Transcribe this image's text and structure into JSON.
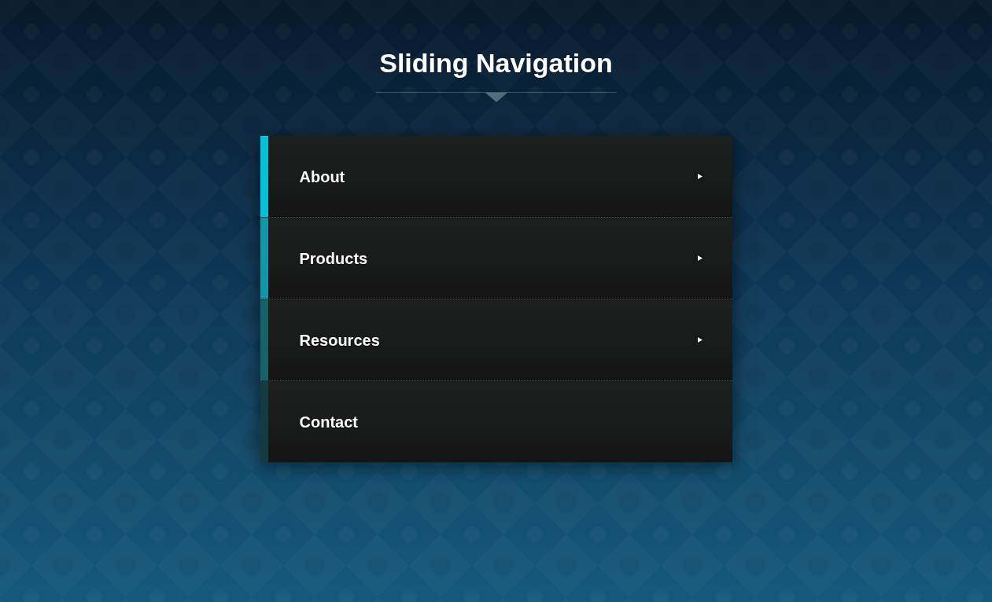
{
  "title": "Sliding Navigation",
  "menu": {
    "items": [
      {
        "label": "About",
        "color": "#00c2da",
        "has_submenu": true
      },
      {
        "label": "Products",
        "color": "#0e98a9",
        "has_submenu": true
      },
      {
        "label": "Resources",
        "color": "#13636d",
        "has_submenu": true
      },
      {
        "label": "Contact",
        "color": "#143b40",
        "has_submenu": false
      }
    ]
  }
}
